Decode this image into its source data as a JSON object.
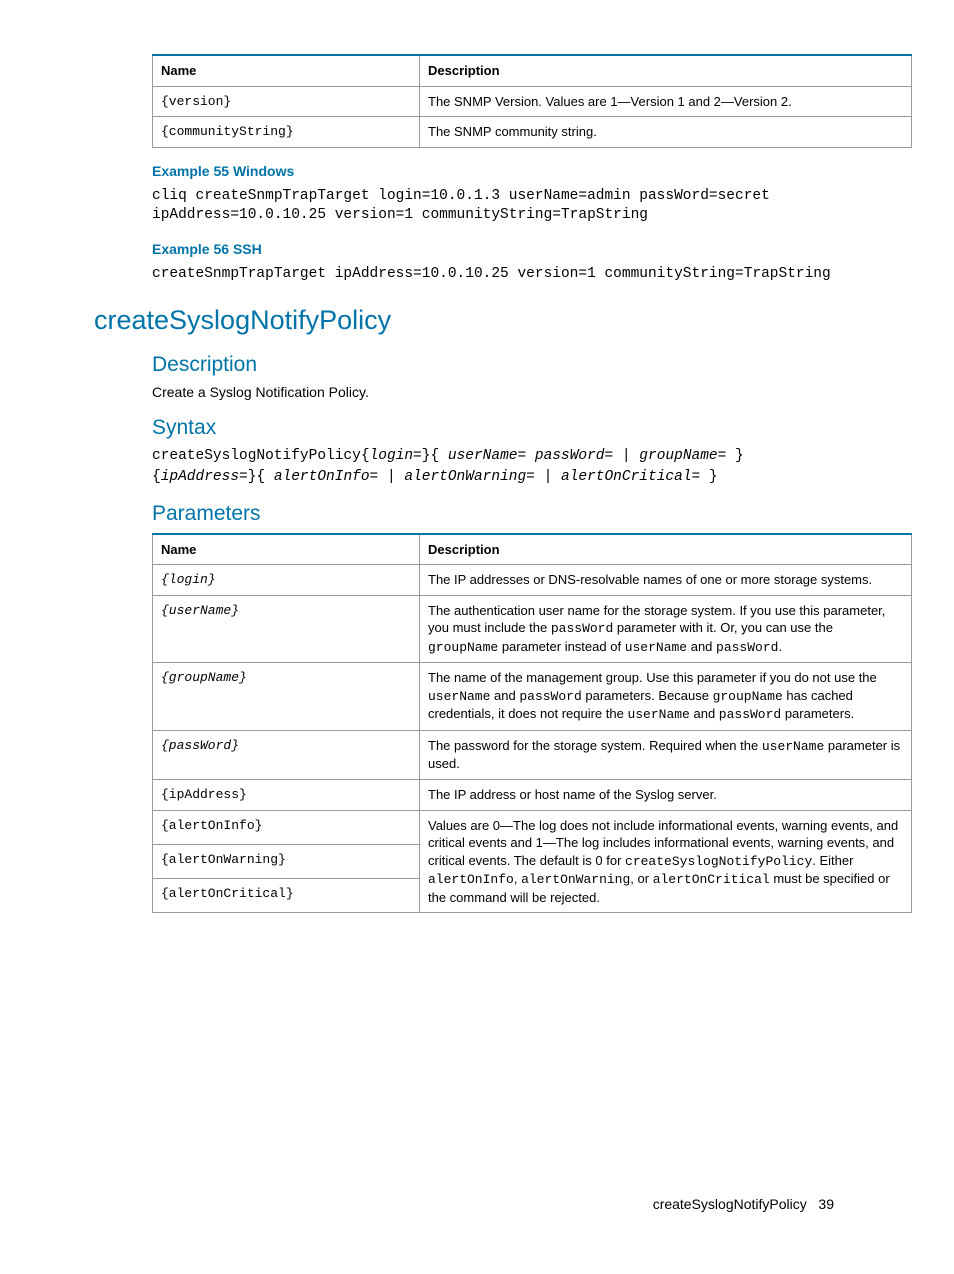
{
  "table1": {
    "headers": {
      "name": "Name",
      "desc": "Description"
    },
    "rows": [
      {
        "name": "{version}",
        "desc": "The SNMP Version. Values are 1—Version 1 and 2—Version 2."
      },
      {
        "name": "{communityString}",
        "desc": "The SNMP community string."
      }
    ]
  },
  "example55": {
    "title": "Example 55 Windows",
    "code": "cliq createSnmpTrapTarget login=10.0.1.3 userName=admin passWord=secret ipAddress=10.0.10.25 version=1 communityString=TrapString"
  },
  "example56": {
    "title": "Example 56 SSH",
    "code": "createSnmpTrapTarget ipAddress=10.0.10.25 version=1 communityString=TrapString"
  },
  "command": {
    "title": "createSyslogNotifyPolicy",
    "description_head": "Description",
    "description_text": "Create a Syslog Notification Policy.",
    "syntax_head": "Syntax",
    "syntax_cmd": "createSyslogNotifyPolicy",
    "syntax_line1a": "{",
    "syntax_line1b": "login=",
    "syntax_line1c": "}{ ",
    "syntax_line1d": "userName= passWord= | groupName=",
    "syntax_line1e": " }",
    "syntax_line2a": "{",
    "syntax_line2b": "ipAddress=",
    "syntax_line2c": "}{ ",
    "syntax_line2d": "alertOnInfo= | alertOnWarning= | alertOnCritical=",
    "syntax_line2e": " }",
    "parameters_head": "Parameters"
  },
  "table2": {
    "headers": {
      "name": "Name",
      "desc": "Description"
    },
    "rows": {
      "login": {
        "name": "{login}",
        "desc": "The IP addresses or DNS-resolvable names of one or more storage systems."
      },
      "userName": {
        "name": "{userName}",
        "d1": "The authentication user name for the storage system. If you use this parameter, you must include the ",
        "d2": "passWord",
        "d3": " parameter with it. Or, you can use the ",
        "d4": "groupName",
        "d5": " parameter instead of ",
        "d6": "userName",
        "d7": " and ",
        "d8": "passWord",
        "d9": "."
      },
      "groupName": {
        "name": "{groupName}",
        "d1": "The name of the management group. Use this parameter if you do not use the ",
        "d2": "userName",
        "d3": " and ",
        "d4": "passWord",
        "d5": " parameters. Because ",
        "d6": "groupName",
        "d7": " has cached credentials, it does not require the ",
        "d8": "userName",
        "d9": " and ",
        "d10": "passWord",
        "d11": " parameters."
      },
      "passWord": {
        "name": "{passWord}",
        "d1": "The password for the storage system. Required when the ",
        "d2": "userName",
        "d3": " parameter is used."
      },
      "ipAddress": {
        "name": "{ipAddress}",
        "desc": "The IP address or host name of the Syslog server."
      },
      "alertOnInfo": {
        "name": "{alertOnInfo}"
      },
      "alertOnWarning": {
        "name": "{alertOnWarning}"
      },
      "alertOnCritical": {
        "name": "{alertOnCritical}"
      },
      "alertDesc": {
        "d1": "Values are 0—The log does not include informational events, warning events, and critical events and 1—The log includes informational events, warning events, and critical events. The default is 0 for ",
        "d2": "createSyslogNotifyPolicy",
        "d3": ". Either ",
        "d4": "alertOnInfo",
        "d5": ", ",
        "d6": "alertOnWarning",
        "d7": ", or ",
        "d8": "alertOnCritical",
        "d9": " must be specified or the command will be rejected."
      }
    }
  },
  "footer": {
    "label": "createSyslogNotifyPolicy",
    "page": "39"
  }
}
